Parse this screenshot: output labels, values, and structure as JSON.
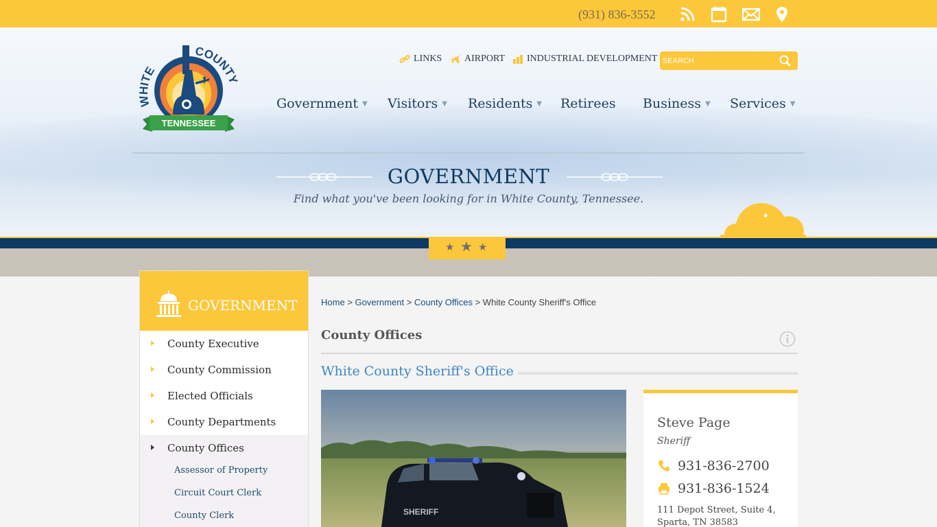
{
  "topbar": {
    "phone": "(931) 836-3552",
    "icons": [
      "rss-icon",
      "calendar-icon",
      "mail-icon",
      "map-pin-icon"
    ]
  },
  "header": {
    "logo": {
      "top_text": "WHITE COUNTY",
      "banner_text": "TENNESSEE"
    },
    "utility_links": [
      {
        "label": "LINKS",
        "icon": "link-icon"
      },
      {
        "label": "AIRPORT",
        "icon": "airplane-icon"
      },
      {
        "label": "INDUSTRIAL DEVELOPMENT",
        "icon": "bar-chart-icon"
      }
    ],
    "search": {
      "placeholder": "SEARCH"
    },
    "nav": [
      {
        "label": "Government",
        "has_dropdown": true
      },
      {
        "label": "Visitors",
        "has_dropdown": true
      },
      {
        "label": "Residents",
        "has_dropdown": true
      },
      {
        "label": "Retirees",
        "has_dropdown": false
      },
      {
        "label": "Business",
        "has_dropdown": true
      },
      {
        "label": "Services",
        "has_dropdown": true
      }
    ],
    "page_title": "GOVERNMENT",
    "page_subtitle": "Find what you've been looking for in White County, Tennessee."
  },
  "sidebar": {
    "title": "GOVERNMENT",
    "items": [
      {
        "label": "County Executive"
      },
      {
        "label": "County Commission"
      },
      {
        "label": "Elected Officials"
      },
      {
        "label": "County Departments"
      },
      {
        "label": "County Offices"
      }
    ],
    "subitems": [
      {
        "label": "Assessor of Property"
      },
      {
        "label": "Circuit Court Clerk"
      },
      {
        "label": "County Clerk"
      }
    ]
  },
  "breadcrumb": {
    "links": [
      "Home",
      "Government",
      "County Offices"
    ],
    "separator": ">",
    "current": "White County Sheriff's Office"
  },
  "main": {
    "section_title": "County Offices",
    "page_heading": "White County Sheriff's Office"
  },
  "contact_card": {
    "name": "Steve Page",
    "role": "Sheriff",
    "phone": "931-836-2700",
    "fax": "931-836-1524",
    "address_line1": "111 Depot Street, Suite 4,",
    "address_line2": "Sparta, TN 38583"
  },
  "colors": {
    "accent_yellow": "#fcc73a",
    "navy": "#0c3a62",
    "link_blue": "#1a4f80",
    "heading_blue": "#3b86c4"
  }
}
